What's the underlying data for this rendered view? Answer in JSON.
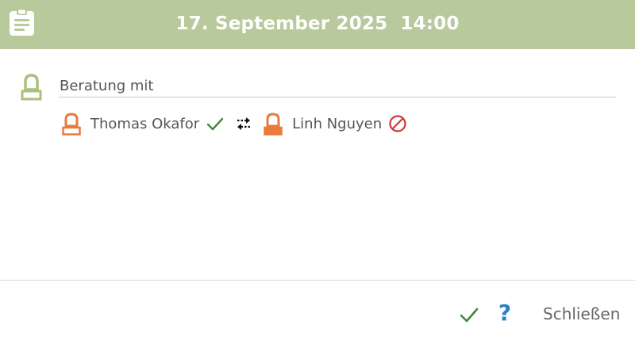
{
  "header": {
    "date": "17. September 2025",
    "time": "14:00",
    "clipboard_icon": "clipboard-icon",
    "color": "#b8c99c"
  },
  "subject": {
    "value": "Beratung mit",
    "person_icon": "person-icon"
  },
  "participants": [
    {
      "name": "Thomas Okafor",
      "status": "confirmed",
      "status_icon": "checkmark-icon",
      "icon_color": "#ea7a3d"
    },
    {
      "name": "Linh Nguyen",
      "status": "declined",
      "status_icon": "blocked-icon",
      "icon_color": "#ea7a3d"
    }
  ],
  "swap_icon": "swap-arrows-icon",
  "footer": {
    "confirm_icon": "checkmark-icon",
    "help_label": "?",
    "close_label": "Schließen"
  },
  "colors": {
    "accent_green": "#b8c99c",
    "person_orange": "#ea7a3d",
    "check_green": "#3f8a3a",
    "block_red": "#d0363c",
    "help_blue": "#2a82c4"
  }
}
